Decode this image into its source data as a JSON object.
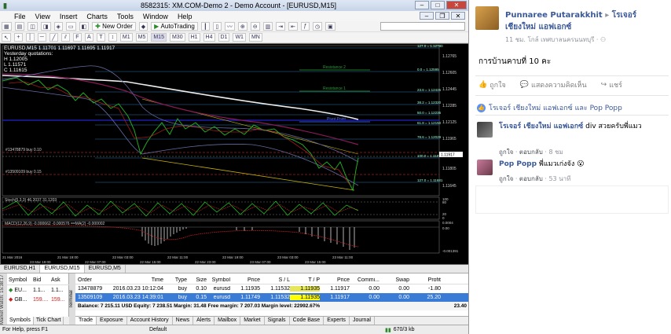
{
  "window": {
    "title": "8582315: XM.COM-Demo 2 - Demo Account - [EURUSD,M15]"
  },
  "menu": [
    "File",
    "View",
    "Insert",
    "Charts",
    "Tools",
    "Window",
    "Help"
  ],
  "toolbar": {
    "new_order": "New Order",
    "auto_trading": "AutoTrading",
    "timeframes": [
      "M1",
      "M5",
      "M15",
      "M30",
      "H1",
      "H4",
      "D1",
      "W1",
      "MN"
    ]
  },
  "chart": {
    "header": "EURUSD,M15  1.11701 1.11697 1.11695 1.11917",
    "header2": "Yesterday quotations:",
    "header3": "H 1.12005",
    "header4": "L 1.11571",
    "header5": "C 1.11615",
    "order1": "#13478879 buy 0.10",
    "order2": "#13509109 buy 0.15",
    "stoch_label": "Stoch(5,3,3) 46.2037 31.1203",
    "macd_label": "MACD(12,26,9) -0.000662 -0.000576 ==MA(2) -0.000002",
    "resistance1": "Resistance 1",
    "resistance2": "Resistance 2",
    "pivot": "Pivot Point",
    "support1": "Support 1",
    "fibs": [
      "127.0 = 1.12790",
      "0.0 = 1.12595",
      "23.6 = 1.12425",
      "38.2 = 1.12320",
      "50.0 = 1.12235",
      "61.8 = 1.12150",
      "78.6 = 1.12029",
      "100.0 = 1.11875",
      "127.0 = 1.11681"
    ],
    "price_labels": [
      "1.12765",
      "1.12605",
      "1.12445",
      "1.12285",
      "1.12125",
      "1.11965",
      "1.11805",
      "1.11645"
    ],
    "cur_price": "1.11917",
    "stoch_axis": [
      "100",
      "80",
      "20",
      "0"
    ],
    "macd_axis": [
      "0.0004",
      "0.00",
      "-0.001391"
    ],
    "time_labels": [
      "21 Mar 2016",
      "21 Mar 19:00",
      "22 Mar 03:00",
      "22 Mar 11:00",
      "22 Mar 19:00",
      "23 Mar 03:00",
      "23 Mar 11:00",
      "23 Mar 19:00",
      "22 Mar 07:00",
      "22 Mar 15:00",
      "22 Mar 23:00",
      "23 Mar 07:00",
      "23 Mar 15:00"
    ]
  },
  "chart_tabs": [
    "EURUSD,H1",
    "EURUSD,M15",
    "EURUSD,M5"
  ],
  "market_watch": {
    "side_label": "Market Watch: 15:38:17",
    "headers": [
      "Symbol",
      "Bid",
      "Ask"
    ],
    "rows": [
      {
        "symbol": "EU...",
        "bid": "1.1...",
        "ask": "1.1..."
      },
      {
        "symbol": "GB...",
        "bid": "159....",
        "ask": "159..."
      }
    ],
    "tabs": [
      "Symbols",
      "Tick Chart"
    ]
  },
  "terminal": {
    "side_label": "Terminal",
    "headers": [
      "Order",
      "Time",
      "Type",
      "Size",
      "Symbol",
      "Price",
      "S / L",
      "T / P",
      "Price",
      "Commi...",
      "Swap",
      "Profit"
    ],
    "rows": [
      {
        "order": "13478879",
        "time": "2016.03.23 10:12:04",
        "type": "buy",
        "size": "0.10",
        "symbol": "eurusd",
        "price": "1.11935",
        "sl": "1.11532",
        "tp": "1.11935",
        "price2": "1.11917",
        "commission": "0.00",
        "swap": "0.00",
        "profit": "-1.80"
      },
      {
        "order": "13509109",
        "time": "2016.03.23 14:39:01",
        "type": "buy",
        "size": "0.15",
        "symbol": "eurusd",
        "price": "1.11749",
        "sl": "1.11532",
        "tp": "1.11935",
        "price2": "1.11917",
        "commission": "0.00",
        "swap": "0.00",
        "profit": "25.20"
      }
    ],
    "balance": "Balance: 7 215.11 USD  Equity: 7 238.51  Margin: 31.48  Free margin: 7 207.03  Margin level: 22992.67%",
    "balance_profit": "23.40",
    "tabs": [
      "Trade",
      "Exposure",
      "Account History",
      "News",
      "Alerts",
      "Mailbox",
      "Market",
      "Signals",
      "Code Base",
      "Experts",
      "Journal"
    ]
  },
  "status": {
    "help": "For Help, press F1",
    "profile": "Default",
    "traffic": "670/3 kb"
  },
  "facebook": {
    "poster": "Punnaree Putarakkhit",
    "arrow": "▸",
    "target": "โรเจอร์ เชียงใหม่ แอฟเอกซ์",
    "meta": "11 ชม. โกล์ เทศบาลนครนนทบุรี · ",
    "post_text": "การบ้านคาบที่ 10 คะ",
    "like": "ถูกใจ",
    "comment": "แสดงความคิดเห็น",
    "share": "แชร์",
    "likes_line": "โรเจอร์ เชียงใหม่ แอฟเอกซ์ และ Pop Popp",
    "comments": [
      {
        "name": "โรเจอร์ เชียงใหม่ แอฟเอกซ์",
        "text": "div สวยครับพี่แมว",
        "like": "ถูกใจ",
        "reply": "ตอบกลับ",
        "time": "8 ชม"
      },
      {
        "name": "Pop Popp",
        "text": "พี่แมวเก่งจัง",
        "like": "ถูกใจ",
        "reply": "ตอบกลับ",
        "time": "53 นาที"
      }
    ]
  }
}
